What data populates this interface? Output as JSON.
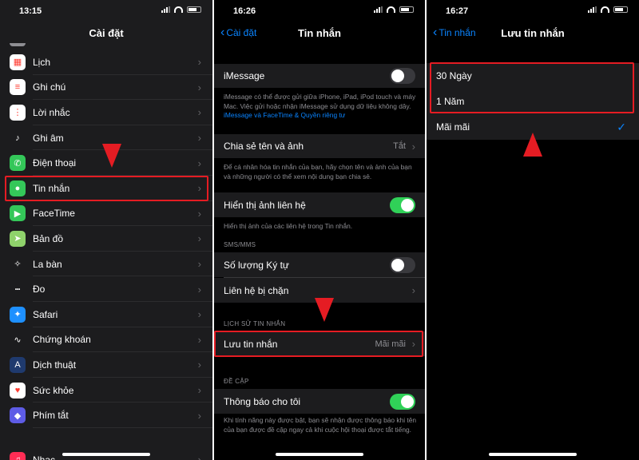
{
  "panel1": {
    "status_time": "13:15",
    "title": "Cài đặt",
    "items": [
      {
        "label": "Lịch",
        "icon": "calendar-icon",
        "color": "#ffffff",
        "glyph": "▦"
      },
      {
        "label": "Ghi chú",
        "icon": "notes-icon",
        "color": "#ffffff",
        "glyph": "≡"
      },
      {
        "label": "Lời nhắc",
        "icon": "reminders-icon",
        "color": "#ffffff",
        "glyph": "⋮"
      },
      {
        "label": "Ghi âm",
        "icon": "voice-memos-icon",
        "color": "#1c1c1e",
        "glyph": "♪"
      },
      {
        "label": "Điện thoại",
        "icon": "phone-icon",
        "color": "#34c759",
        "glyph": "✆"
      },
      {
        "label": "Tin nhắn",
        "icon": "messages-icon",
        "color": "#34c759",
        "glyph": "●"
      },
      {
        "label": "FaceTime",
        "icon": "facetime-icon",
        "color": "#34c759",
        "glyph": "▶"
      },
      {
        "label": "Bản đồ",
        "icon": "maps-icon",
        "color": "#8fd26b",
        "glyph": "➤"
      },
      {
        "label": "La bàn",
        "icon": "compass-icon",
        "color": "#1c1c1e",
        "glyph": "✧"
      },
      {
        "label": "Đo",
        "icon": "measure-icon",
        "color": "#1c1c1e",
        "glyph": "┅"
      },
      {
        "label": "Safari",
        "icon": "safari-icon",
        "color": "#1e90ff",
        "glyph": "✦"
      },
      {
        "label": "Chứng khoán",
        "icon": "stocks-icon",
        "color": "#1c1c1e",
        "glyph": "∿"
      },
      {
        "label": "Dịch thuật",
        "icon": "translate-icon",
        "color": "#1f3a6e",
        "glyph": "A"
      },
      {
        "label": "Sức khỏe",
        "icon": "health-icon",
        "color": "#ffffff",
        "glyph": "♥"
      },
      {
        "label": "Phím tắt",
        "icon": "shortcuts-icon",
        "color": "#5e5ce6",
        "glyph": "◆"
      },
      {
        "label": "Nhạc",
        "icon": "music-icon",
        "color": "#ff2d55",
        "glyph": "♫"
      }
    ]
  },
  "panel2": {
    "status_time": "16:26",
    "back_label": "Cài đặt",
    "title": "Tin nhắn",
    "imessage_label": "iMessage",
    "imessage_note": "iMessage có thể được gửi giữa iPhone, iPad, iPod touch và máy Mac. Việc gửi hoặc nhận iMessage sử dụng dữ liệu không dây.",
    "imessage_link": "iMessage và FaceTime & Quyền riêng tư",
    "share_label": "Chia sẻ tên và ảnh",
    "share_value": "Tắt",
    "share_note": "Để cá nhân hóa tin nhắn của bạn, hãy chọn tên và ảnh của bạn và những người có thể xem nội dung bạn chia sẻ.",
    "contact_photos_label": "Hiển thị ảnh liên hệ",
    "contact_photos_note": "Hiển thị ảnh của các liên hệ trong Tin nhắn.",
    "sms_header": "SMS/MMS",
    "char_count_label": "Số lượng Ký tự",
    "blocked_label": "Liên hệ bị chặn",
    "history_header": "LỊCH SỬ TIN NHẮN",
    "keep_label": "Lưu tin nhắn",
    "keep_value": "Mãi mãi",
    "mentions_header": "ĐỀ CẬP",
    "notify_label": "Thông báo cho tôi",
    "notify_note": "Khi tính năng này được bật, bạn sẽ nhận được thông báo khi tên của bạn được đề cập ngay cả khi cuộc hội thoại được tắt tiếng."
  },
  "panel3": {
    "status_time": "16:27",
    "back_label": "Tin nhắn",
    "title": "Lưu tin nhắn",
    "options": [
      "30 Ngày",
      "1 Năm",
      "Mãi mãi"
    ],
    "check_mark": "✓"
  },
  "colors": {
    "accent": "#0a84ff",
    "highlight": "#e51c23",
    "toggle_on": "#30d158"
  }
}
